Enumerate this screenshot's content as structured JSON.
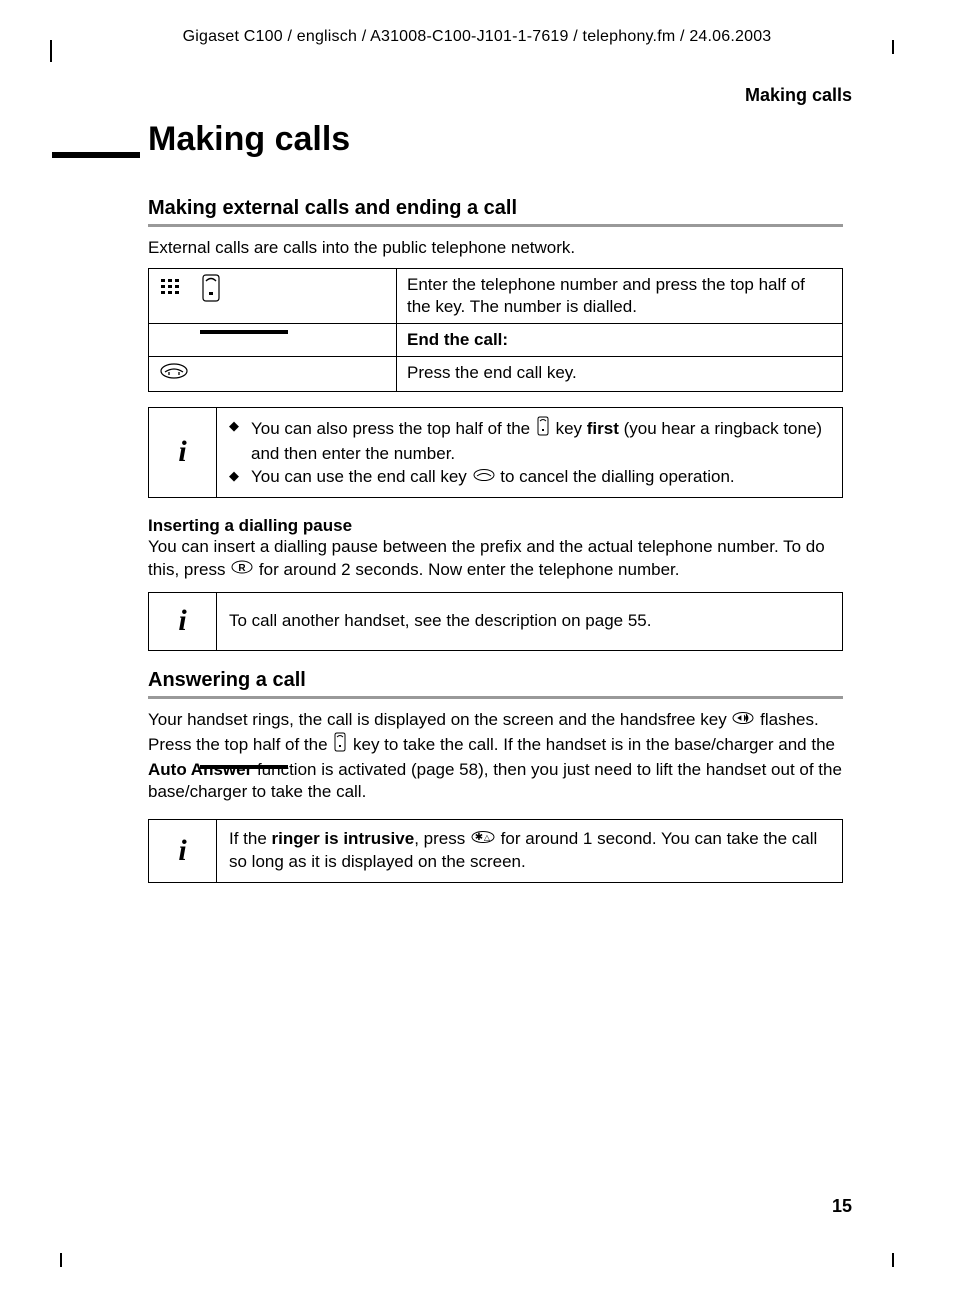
{
  "header": "Gigaset C100 / englisch / A31008-C100-J101-1-7619 / telephony.fm / 24.06.2003",
  "running_head": "Making calls",
  "chapter_title": "Making calls",
  "sections": {
    "external": {
      "heading": "Making external calls and ending a call",
      "intro": "External calls are calls into the public telephone network.",
      "table": {
        "row1": "Enter the telephone number and press the top half of the key. The number is dialled.",
        "row2_label": "End the call:",
        "row3": "Press the end call key."
      },
      "info1": {
        "bullet1_pre": "You can also press the top half of the ",
        "bullet1_mid": " key ",
        "bullet1_bold": "first",
        "bullet1_post": " (you hear a ringback tone) and then enter the number.",
        "bullet2_pre": "You can use the end call key ",
        "bullet2_post": " to cancel the dialling operation."
      },
      "pause": {
        "heading": "Inserting a dialling pause",
        "line1": "You can insert a dialling pause between the prefix and the actual telephone number. To do this, press ",
        "line1_post": " for around 2 seconds. Now enter the telephone number."
      },
      "info2": "To call another handset, see the description on page 55."
    },
    "answering": {
      "heading": "Answering a call",
      "para_pre": "Your handset rings, the call is displayed on the screen and the handsfree key ",
      "para_mid1": " flashes. Press the top half of the ",
      "para_mid2": " key to take the call. If the handset is in the base/charger and the ",
      "para_bold": "Auto Answer",
      "para_post": " function is activated (page 58), then you just need to lift the handset out of the base/charger to take the call.",
      "info": {
        "pre": "If the ",
        "bold": "ringer is intrusive",
        "mid": ", press ",
        "post": " for around 1 second. You can take the call so long as it is displayed on the screen."
      }
    }
  },
  "page_number": "15",
  "icons": {
    "keypad": "keypad-icon",
    "talk": "talk-key-icon",
    "endcall": "end-call-key-icon",
    "r": "r-key-icon",
    "speaker": "speaker-key-icon",
    "star": "star-key-icon"
  }
}
